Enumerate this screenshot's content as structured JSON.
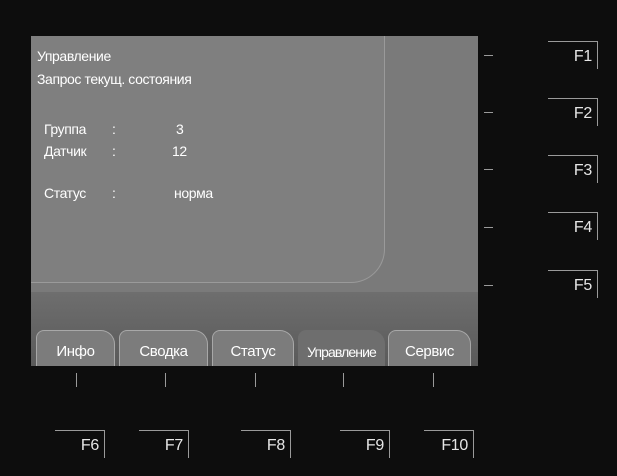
{
  "screen": {
    "title": "Управление",
    "subtitle": "Запрос текущ. состояния",
    "fields": [
      {
        "label": "Группа",
        "sep": ":",
        "value": "3"
      },
      {
        "label": "Датчик",
        "sep": ":",
        "value": "12"
      },
      {
        "label": "Статус",
        "sep": ":",
        "value": "норма"
      }
    ]
  },
  "tabs": [
    {
      "label": "Инфо"
    },
    {
      "label": "Сводка"
    },
    {
      "label": "Статус"
    },
    {
      "label": "Управление",
      "active": true
    },
    {
      "label": "Сервис"
    }
  ],
  "right_keys": [
    "F1",
    "F2",
    "F3",
    "F4",
    "F5"
  ],
  "bottom_keys": [
    "F6",
    "F7",
    "F8",
    "F9",
    "F10"
  ],
  "colors": {
    "background": "#0d0d0d",
    "screen": "#7a7a7a",
    "text": "#ffffff"
  }
}
